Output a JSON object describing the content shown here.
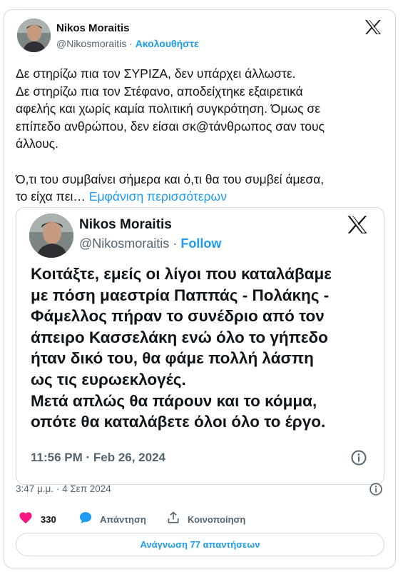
{
  "tweet": {
    "author_name": "Nikos Moraitis",
    "author_handle": "@Nikosmoraitis",
    "separator": "·",
    "follow_label": "Ακολουθήστε",
    "text_lines": [
      "Δε στηρίζω πια τον ΣΥΡΙΖΑ, δεν υπάρχει άλλωστε.",
      "Δε στηρίζω πια τον Στέφανο, αποδείχτηκε εξαιρετικά",
      "αφελής και χωρίς καμία πολιτική συγκρότηση. Όμως σε",
      "επίπεδο ανθρώπου, δεν είσαι σκ@τάνθρωπος σαν τους",
      "άλλους.",
      "",
      "Ό,τι του συμβαίνει σήμερα και ό,τι θα του συμβεί άμεσα,"
    ],
    "last_line_prefix": "το είχα πει…",
    "show_more_label": "Εμφάνιση περισσότερων",
    "timestamp": "3:47 μ.μ. · 4 Σεπ 2024",
    "likes_count": "330",
    "reply_label": "Απάντηση",
    "share_label": "Κοινοποίηση",
    "read_replies_label": "Ανάγνωση 77 απαντήσεων"
  },
  "quoted": {
    "author_name": "Nikos Moraitis",
    "author_handle": "@Nikosmoraitis",
    "separator": "·",
    "follow_label": "Follow",
    "text_lines": [
      "Κοιτάξτε, εμείς οι λίγοι που καταλάβαμε",
      "με πόση μαεστρία Παππάς - Πολάκης -",
      "Φάμελλος πήραν το συνέδριο από τον",
      "άπειρο Κασσελάκη ενώ όλο το γήπεδο",
      "ήταν δικό του, θα φάμε πολλή λάσπη",
      "ως τις ευρωεκλογές.",
      "Μετά απλώς θα πάρουν και το κόμμα,",
      "οπότε θα καταλάβετε όλοι όλο το έργο."
    ],
    "time": "11:56 PM · Feb 26, 2024"
  },
  "icons": {
    "logo": "x-logo-icon",
    "like": "heart-icon",
    "reply": "speech-bubble-icon",
    "share": "share-upload-icon",
    "info": "info-icon"
  },
  "colors": {
    "accent": "#1d9bf0",
    "heart": "#f91880",
    "muted": "#536471",
    "border": "#cfd9de",
    "text": "#0f1419"
  }
}
